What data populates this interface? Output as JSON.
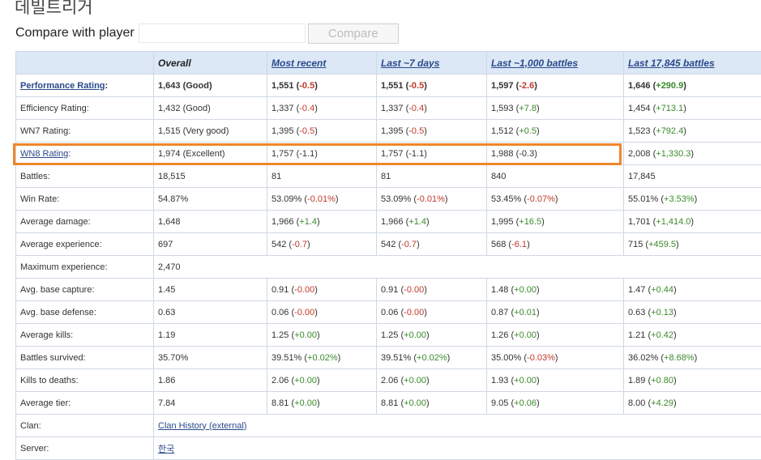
{
  "player": {
    "name": "데빌트리거"
  },
  "compare": {
    "label": "Compare with player",
    "input_value": "",
    "button_label": "Compare"
  },
  "headers": [
    "",
    "Overall",
    "Most recent",
    "Last ~7 days",
    "Last ~1,000 battles",
    "Last 17,845 battles"
  ],
  "rows": [
    {
      "label": "Performance Rating",
      "suffix": ":",
      "label_link": true,
      "bold": true,
      "cells": [
        {
          "text": "1,643 (Good)",
          "delta": "",
          "sign": ""
        },
        {
          "text": "1,551",
          "delta": "-0.5",
          "sign": "neg"
        },
        {
          "text": "1,551",
          "delta": "-0.5",
          "sign": "neg"
        },
        {
          "text": "1,597",
          "delta": "-2.6",
          "sign": "neg"
        },
        {
          "text": "1,646",
          "delta": "+290.9",
          "sign": "pos"
        }
      ]
    },
    {
      "label": "Efficiency Rating:",
      "suffix": "",
      "label_link": false,
      "bold": false,
      "cells": [
        {
          "text": "1,432 (Good)",
          "delta": "",
          "sign": ""
        },
        {
          "text": "1,337",
          "delta": "-0.4",
          "sign": "neg"
        },
        {
          "text": "1,337",
          "delta": "-0.4",
          "sign": "neg"
        },
        {
          "text": "1,593",
          "delta": "+7.8",
          "sign": "pos"
        },
        {
          "text": "1,454",
          "delta": "+713.1",
          "sign": "pos"
        }
      ]
    },
    {
      "label": "WN7 Rating:",
      "suffix": "",
      "label_link": false,
      "bold": false,
      "cells": [
        {
          "text": "1,515 (Very good)",
          "delta": "",
          "sign": ""
        },
        {
          "text": "1,395",
          "delta": "-0.5",
          "sign": "neg"
        },
        {
          "text": "1,395",
          "delta": "-0.5",
          "sign": "neg"
        },
        {
          "text": "1,512",
          "delta": "+0.5",
          "sign": "pos"
        },
        {
          "text": "1,523",
          "delta": "+792.4",
          "sign": "pos"
        }
      ]
    },
    {
      "label": "WN8 Rating",
      "suffix": ":",
      "label_link": true,
      "bold": false,
      "cells": [
        {
          "text": "1,974 (Excellent)",
          "delta": "",
          "sign": ""
        },
        {
          "text": "1,757",
          "delta": "-1.1",
          "sign": "neutral"
        },
        {
          "text": "1,757",
          "delta": "-1.1",
          "sign": "neutral"
        },
        {
          "text": "1,988",
          "delta": "-0.3",
          "sign": "neutral"
        },
        {
          "text": "2,008",
          "delta": "+1,330.3",
          "sign": "pos"
        }
      ]
    },
    {
      "label": "Battles:",
      "suffix": "",
      "label_link": false,
      "bold": false,
      "cells": [
        {
          "text": "18,515",
          "delta": "",
          "sign": ""
        },
        {
          "text": "81",
          "delta": "",
          "sign": ""
        },
        {
          "text": "81",
          "delta": "",
          "sign": ""
        },
        {
          "text": "840",
          "delta": "",
          "sign": ""
        },
        {
          "text": "17,845",
          "delta": "",
          "sign": ""
        }
      ]
    },
    {
      "label": "Win Rate:",
      "suffix": "",
      "label_link": false,
      "bold": false,
      "cells": [
        {
          "text": "54.87%",
          "delta": "",
          "sign": ""
        },
        {
          "text": "53.09%",
          "delta": "-0.01%",
          "sign": "neg"
        },
        {
          "text": "53.09%",
          "delta": "-0.01%",
          "sign": "neg"
        },
        {
          "text": "53.45%",
          "delta": "-0.07%",
          "sign": "neg"
        },
        {
          "text": "55.01%",
          "delta": "+3.53%",
          "sign": "pos"
        }
      ]
    },
    {
      "label": "Average damage:",
      "suffix": "",
      "label_link": false,
      "bold": false,
      "cells": [
        {
          "text": "1,648",
          "delta": "",
          "sign": ""
        },
        {
          "text": "1,966",
          "delta": "+1.4",
          "sign": "pos"
        },
        {
          "text": "1,966",
          "delta": "+1.4",
          "sign": "pos"
        },
        {
          "text": "1,995",
          "delta": "+16.5",
          "sign": "pos"
        },
        {
          "text": "1,701",
          "delta": "+1,414.0",
          "sign": "pos"
        }
      ]
    },
    {
      "label": "Average experience:",
      "suffix": "",
      "label_link": false,
      "bold": false,
      "cells": [
        {
          "text": "697",
          "delta": "",
          "sign": ""
        },
        {
          "text": "542",
          "delta": "-0.7",
          "sign": "neg"
        },
        {
          "text": "542",
          "delta": "-0.7",
          "sign": "neg"
        },
        {
          "text": "568",
          "delta": "-6.1",
          "sign": "neg"
        },
        {
          "text": "715",
          "delta": "+459.5",
          "sign": "pos"
        }
      ]
    },
    {
      "label": "Maximum experience:",
      "suffix": "",
      "label_link": false,
      "bold": false,
      "span_text": "2,470"
    },
    {
      "label": "Avg. base capture:",
      "suffix": "",
      "label_link": false,
      "bold": false,
      "cells": [
        {
          "text": "1.45",
          "delta": "",
          "sign": ""
        },
        {
          "text": "0.91",
          "delta": "-0.00",
          "sign": "neg"
        },
        {
          "text": "0.91",
          "delta": "-0.00",
          "sign": "neg"
        },
        {
          "text": "1.48",
          "delta": "+0.00",
          "sign": "pos"
        },
        {
          "text": "1.47",
          "delta": "+0.44",
          "sign": "pos"
        }
      ]
    },
    {
      "label": "Avg. base defense:",
      "suffix": "",
      "label_link": false,
      "bold": false,
      "cells": [
        {
          "text": "0.63",
          "delta": "",
          "sign": ""
        },
        {
          "text": "0.06",
          "delta": "-0.00",
          "sign": "neg"
        },
        {
          "text": "0.06",
          "delta": "-0.00",
          "sign": "neg"
        },
        {
          "text": "0.87",
          "delta": "+0.01",
          "sign": "pos"
        },
        {
          "text": "0.63",
          "delta": "+0.13",
          "sign": "pos"
        }
      ]
    },
    {
      "label": "Average kills:",
      "suffix": "",
      "label_link": false,
      "bold": false,
      "cells": [
        {
          "text": "1.19",
          "delta": "",
          "sign": ""
        },
        {
          "text": "1.25",
          "delta": "+0.00",
          "sign": "pos"
        },
        {
          "text": "1.25",
          "delta": "+0.00",
          "sign": "pos"
        },
        {
          "text": "1.26",
          "delta": "+0.00",
          "sign": "pos"
        },
        {
          "text": "1.21",
          "delta": "+0.42",
          "sign": "pos"
        }
      ]
    },
    {
      "label": "Battles survived:",
      "suffix": "",
      "label_link": false,
      "bold": false,
      "cells": [
        {
          "text": "35.70%",
          "delta": "",
          "sign": ""
        },
        {
          "text": "39.51%",
          "delta": "+0.02%",
          "sign": "pos"
        },
        {
          "text": "39.51%",
          "delta": "+0.02%",
          "sign": "pos"
        },
        {
          "text": "35.00%",
          "delta": "-0.03%",
          "sign": "neg"
        },
        {
          "text": "36.02%",
          "delta": "+8.68%",
          "sign": "pos"
        }
      ]
    },
    {
      "label": "Kills to deaths:",
      "suffix": "",
      "label_link": false,
      "bold": false,
      "cells": [
        {
          "text": "1.86",
          "delta": "",
          "sign": ""
        },
        {
          "text": "2.06",
          "delta": "+0.00",
          "sign": "pos"
        },
        {
          "text": "2.06",
          "delta": "+0.00",
          "sign": "pos"
        },
        {
          "text": "1.93",
          "delta": "+0.00",
          "sign": "pos"
        },
        {
          "text": "1.89",
          "delta": "+0.80",
          "sign": "pos"
        }
      ]
    },
    {
      "label": "Average tier:",
      "suffix": "",
      "label_link": false,
      "bold": false,
      "cells": [
        {
          "text": "7.84",
          "delta": "",
          "sign": ""
        },
        {
          "text": "8.81",
          "delta": "+0.00",
          "sign": "pos"
        },
        {
          "text": "8.81",
          "delta": "+0.00",
          "sign": "pos"
        },
        {
          "text": "9.05",
          "delta": "+0.06",
          "sign": "pos"
        },
        {
          "text": "8.00",
          "delta": "+4.29",
          "sign": "pos"
        }
      ]
    },
    {
      "label": "Clan:",
      "suffix": "",
      "label_link": false,
      "bold": false,
      "span_text": "Clan History (external)",
      "span_link": true
    },
    {
      "label": "Server:",
      "suffix": "",
      "label_link": false,
      "bold": false,
      "span_text": "한국",
      "span_link": true
    }
  ],
  "colors": {
    "header_bg": "#dde8f6",
    "positive": "#3a8a2a",
    "negative": "#c0392b",
    "highlight": "#f0862d"
  }
}
